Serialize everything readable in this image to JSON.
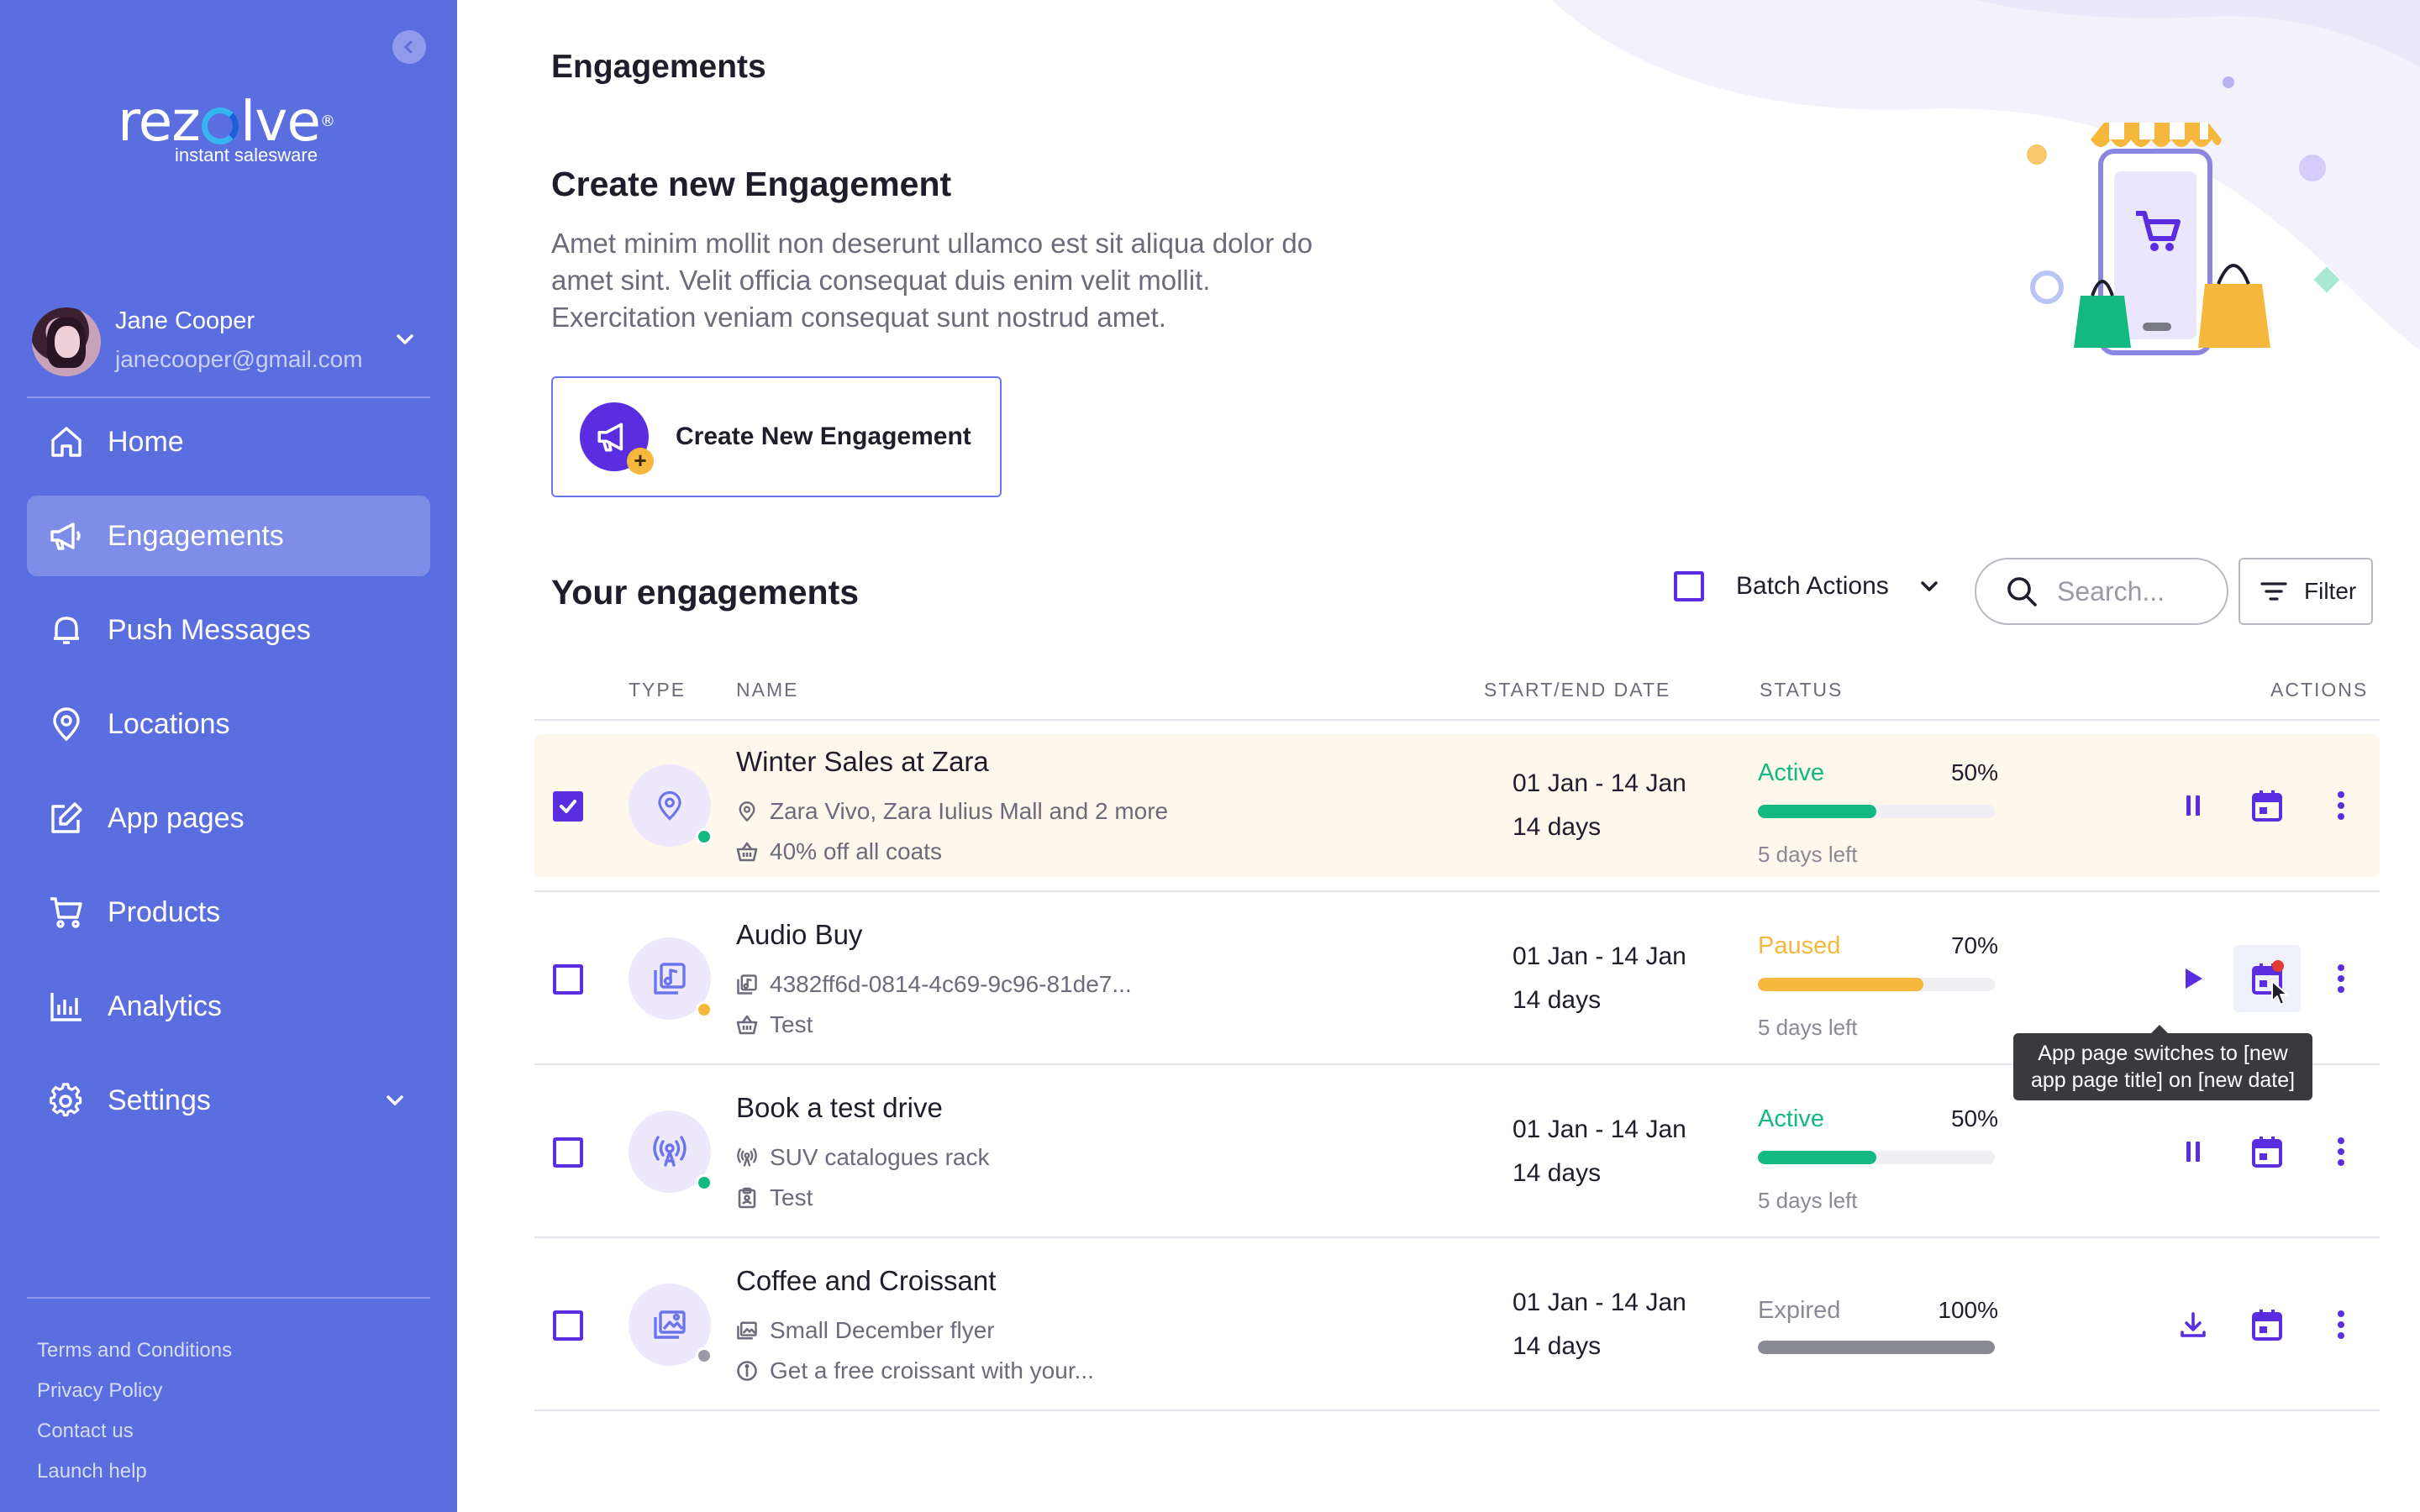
{
  "brand": {
    "name_prefix": "rez",
    "name_suffix": "lve",
    "registered": "®",
    "tagline": "instant salesware"
  },
  "user": {
    "name": "Jane Cooper",
    "email": "janecooper@gmail.com"
  },
  "nav": [
    {
      "label": "Home",
      "icon": "home-icon"
    },
    {
      "label": "Engagements",
      "icon": "megaphone-icon",
      "active": true
    },
    {
      "label": "Push Messages",
      "icon": "bell-icon"
    },
    {
      "label": "Locations",
      "icon": "location-pin-icon"
    },
    {
      "label": "App pages",
      "icon": "edit-icon"
    },
    {
      "label": "Products",
      "icon": "cart-icon"
    },
    {
      "label": "Analytics",
      "icon": "bar-chart-icon"
    },
    {
      "label": "Settings",
      "icon": "gear-icon",
      "expandable": true
    }
  ],
  "footer_links": [
    "Terms and Conditions",
    "Privacy Policy",
    "Contact us",
    "Launch help"
  ],
  "page": {
    "title": "Engagements",
    "create_section": {
      "title": "Create new Engagement",
      "description": "Amet minim mollit non deserunt ullamco est sit aliqua dolor do amet sint. Velit officia consequat duis enim velit mollit. Exercitation veniam consequat sunt nostrud amet.",
      "button_label": "Create New Engagement"
    }
  },
  "list": {
    "title": "Your engagements",
    "batch_label": "Batch Actions",
    "search_placeholder": "Search...",
    "filter_label": "Filter",
    "columns": {
      "type": "TYPE",
      "name": "NAME",
      "date": "START/END DATE",
      "status": "STATUS",
      "actions": "ACTIONS"
    }
  },
  "rows": [
    {
      "name": "Winter Sales at Zara",
      "type_icon": "location-pin-icon",
      "checked": true,
      "sub1_icon": "location-pin-icon",
      "sub1": "Zara Vivo, Zara Iulius Mall and 2 more",
      "sub2_icon": "basket-icon",
      "sub2": "40% off all coats",
      "date_range": "01 Jan - 14 Jan",
      "duration": "14 days",
      "status": "Active",
      "percent": "50%",
      "progress": 0.5,
      "days_left": "5 days left",
      "primary_action": "pause-icon"
    },
    {
      "name": "Audio Buy",
      "type_icon": "music-library-icon",
      "checked": false,
      "sub1_icon": "music-file-icon",
      "sub1": "4382ff6d-0814-4c69-9c96-81de7...",
      "sub2_icon": "basket-icon",
      "sub2": "Test",
      "date_range": "01 Jan - 14 Jan",
      "duration": "14 days",
      "status": "Paused",
      "percent": "70%",
      "progress": 0.7,
      "days_left": "5 days left",
      "primary_action": "play-icon"
    },
    {
      "name": "Book a test drive",
      "type_icon": "broadcast-icon",
      "checked": false,
      "sub1_icon": "broadcast-icon",
      "sub1": "SUV catalogues rack",
      "sub2_icon": "clipboard-icon",
      "sub2": "Test",
      "date_range": "01 Jan - 14 Jan",
      "duration": "14 days",
      "status": "Active",
      "percent": "50%",
      "progress": 0.5,
      "days_left": "5 days left",
      "primary_action": "pause-icon"
    },
    {
      "name": "Coffee and Croissant",
      "type_icon": "image-gallery-icon",
      "checked": false,
      "sub1_icon": "image-icon",
      "sub1": "Small December flyer",
      "sub2_icon": "info-icon",
      "sub2": "Get a free croissant with your...",
      "date_range": "01 Jan - 14 Jan",
      "duration": "14 days",
      "status": "Expired",
      "percent": "100%",
      "progress": 1.0,
      "days_left": "",
      "primary_action": "download-icon"
    }
  ],
  "tooltip": "App page switches to [new app page title] on [new date]",
  "colors": {
    "sidebar": "#5a6ee0",
    "accent": "#5a2ee0",
    "active": "#13b981",
    "paused": "#f5b83d",
    "expired": "#8a8a96",
    "selected_row": "#fdf7ec"
  }
}
